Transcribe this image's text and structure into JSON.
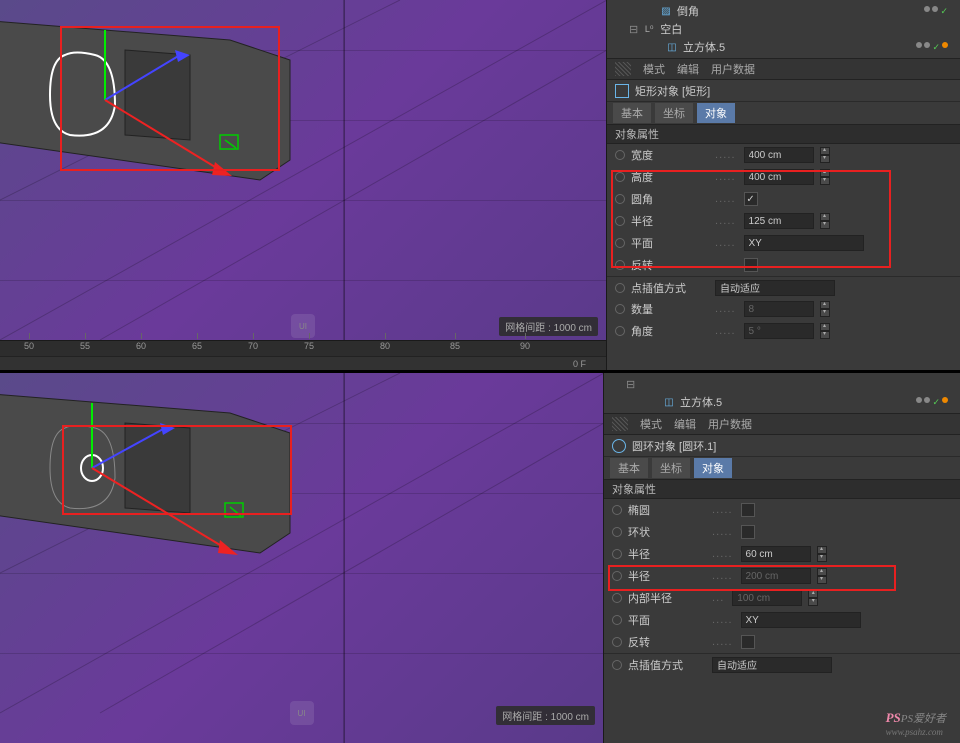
{
  "top": {
    "tree": {
      "item1": "倒角",
      "item2": "空白",
      "item3": "立方体.5"
    },
    "header": {
      "mode": "模式",
      "edit": "编辑",
      "user_data": "用户数据"
    },
    "object_name": "矩形对象 [矩形]",
    "tabs": {
      "basic": "基本",
      "coords": "坐标",
      "object": "对象"
    },
    "section": "对象属性",
    "props": {
      "width_label": "宽度",
      "width_val": "400 cm",
      "height_label": "高度",
      "height_val": "400 cm",
      "fillet_label": "圆角",
      "radius_label": "半径",
      "radius_val": "125 cm",
      "plane_label": "平面",
      "plane_val": "XY",
      "reverse_label": "反转",
      "interp_label": "点插值方式",
      "interp_val": "自动适应",
      "count_label": "数量",
      "count_val": "8",
      "angle_label": "角度",
      "angle_val": "5 °"
    },
    "grid_label": "网格间距 : 1000 cm",
    "ruler": [
      "50",
      "55",
      "60",
      "65",
      "70",
      "75",
      "80",
      "85",
      "90"
    ],
    "ruler2_right": "0 F"
  },
  "bottom": {
    "tree": {
      "item3": "立方体.5"
    },
    "header": {
      "mode": "模式",
      "edit": "编辑",
      "user_data": "用户数据"
    },
    "object_name": "圆环对象 [圆环.1]",
    "tabs": {
      "basic": "基本",
      "coords": "坐标",
      "object": "对象"
    },
    "section": "对象属性",
    "props": {
      "ellipse_label": "椭圆",
      "ring_label": "环状",
      "radius_label": "半径",
      "radius_val": "60 cm",
      "radius2_label": "半径",
      "radius2_val": "200 cm",
      "inner_radius_label": "内部半径",
      "inner_radius_val": "100 cm",
      "plane_label": "平面",
      "plane_val": "XY",
      "reverse_label": "反转",
      "interp_label": "点插值方式",
      "interp_val": "自动适应"
    },
    "grid_label": "网格间距 : 1000 cm"
  },
  "watermark_cn": "UI 中国",
  "watermark_right": "PS爱好者",
  "watermark_url": "www.psahz.com"
}
